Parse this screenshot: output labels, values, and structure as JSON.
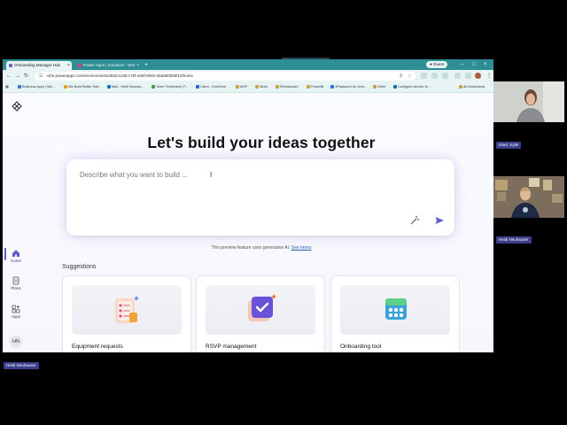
{
  "browser": {
    "tabs": [
      {
        "label": "Onboarding Manager Hub",
        "active": true
      },
      {
        "label": "Power Apps | Solutions - Wor",
        "active": false
      }
    ],
    "new_tab_symbol": "+",
    "guest_label": "Guest",
    "url": "vibe.powerapps.com/environments/d52e1135-c70f-eb8f-8084-46a85005bf10/home",
    "bookmarks": [
      "Business Apps | Mic...",
      "We Build Better Soft...",
      "Mail - Heidi Neuhau...",
      "Toner Timesheet | F...",
      "Client - OneDrive",
      "MVP",
      "Work",
      "Reimbursed",
      "PowerBI",
      "1Password for Jeve...",
      "Other",
      "Configure service te..."
    ],
    "all_bookmarks": "All Bookmarks"
  },
  "app": {
    "rail": {
      "home": "Home",
      "plans": "Plans",
      "apps": "Apps",
      "avatar_initials": "HN"
    },
    "headline": "Let's build your ideas together",
    "prompt": {
      "placeholder": "Describe what you want to build ...",
      "cursor": "I"
    },
    "notice": "This preview feature uses generative AI.",
    "notice_link": "See terms",
    "suggestions_title": "Suggestions",
    "cards": [
      {
        "title": "Equipment requests",
        "icon": "clipboard-checklist-icon"
      },
      {
        "title": "RSVP management",
        "icon": "calendar-check-icon"
      },
      {
        "title": "Onboarding tool",
        "icon": "app-grid-icon"
      }
    ]
  },
  "meeting": {
    "participants": [
      {
        "name": "Kiser, Kylie"
      },
      {
        "name": "Heidi Neuhauser"
      }
    ],
    "presenter_label": "Heidi Neuhauser"
  },
  "colors": {
    "browser_frame": "#2d8f94",
    "accent": "#5b5fc7",
    "name_label": "#3b3f8c"
  }
}
